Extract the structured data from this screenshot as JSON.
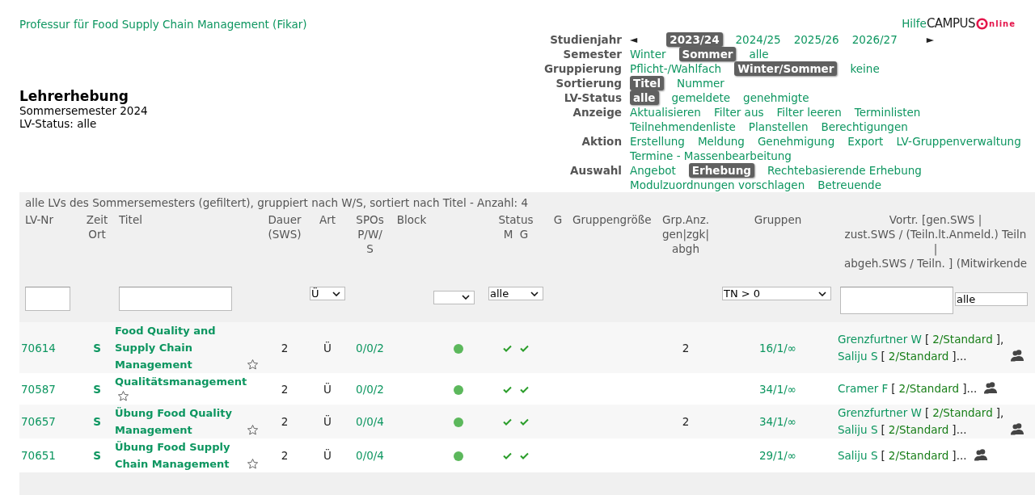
{
  "org_title": "Professur für Food Supply Chain Management (Fikar)",
  "help": "Hilfe",
  "logo": {
    "left": "CAMPUS",
    "right": "nline"
  },
  "page": {
    "title": "Lehrerhebung",
    "subtitle": "Sommersemester 2024",
    "status": "LV-Status: alle"
  },
  "nav": [
    {
      "label": "Studienjahr",
      "prev": "◄",
      "next": "►",
      "items": [
        {
          "text": "2023/24",
          "selected": true
        },
        {
          "text": "2024/25",
          "selected": false
        },
        {
          "text": "2025/26",
          "selected": false
        },
        {
          "text": "2026/27",
          "selected": false
        }
      ]
    },
    {
      "label": "Semester",
      "items": [
        {
          "text": "Winter",
          "selected": false
        },
        {
          "text": "Sommer",
          "selected": true
        },
        {
          "text": "alle",
          "selected": false
        }
      ]
    },
    {
      "label": "Gruppierung",
      "items": [
        {
          "text": "Pflicht-/Wahlfach",
          "selected": false
        },
        {
          "text": "Winter/Sommer",
          "selected": true
        },
        {
          "text": "keine",
          "selected": false
        }
      ]
    },
    {
      "label": "Sortierung",
      "items": [
        {
          "text": "Titel",
          "selected": true
        },
        {
          "text": "Nummer",
          "selected": false
        }
      ]
    },
    {
      "label": "LV-Status",
      "items": [
        {
          "text": "alle",
          "selected": true
        },
        {
          "text": "gemeldete",
          "selected": false
        },
        {
          "text": "genehmigte",
          "selected": false
        }
      ]
    },
    {
      "label": "Anzeige",
      "items": [
        {
          "text": "Aktualisieren",
          "selected": false
        },
        {
          "text": "Filter aus",
          "selected": false
        },
        {
          "text": "Filter leeren",
          "selected": false
        },
        {
          "text": "Terminlisten",
          "selected": false
        },
        {
          "text": "Teilnehmendenliste",
          "selected": false
        },
        {
          "text": "Planstellen",
          "selected": false
        },
        {
          "text": "Berechtigungen",
          "selected": false
        }
      ]
    },
    {
      "label": "Aktion",
      "items": [
        {
          "text": "Erstellung",
          "selected": false
        },
        {
          "text": "Meldung",
          "selected": false
        },
        {
          "text": "Genehmigung",
          "selected": false
        },
        {
          "text": "Export",
          "selected": false
        },
        {
          "text": "LV-Gruppenverwaltung",
          "selected": false
        },
        {
          "text": "Termine - Massenbearbeitung",
          "selected": false
        }
      ]
    },
    {
      "label": "Auswahl",
      "items": [
        {
          "text": "Angebot",
          "selected": false
        },
        {
          "text": "Erhebung",
          "selected": true
        },
        {
          "text": "Rechtebasierende Erhebung",
          "selected": false
        },
        {
          "text": "Modulzuordnungen vorschlagen",
          "selected": false
        },
        {
          "text": "Betreuende",
          "selected": false
        }
      ]
    }
  ],
  "table": {
    "caption": "alle LVs des Sommersemesters (gefiltert), gruppiert nach W/S, sortiert nach Titel - Anzahl: 4",
    "columns": [
      {
        "lines": [
          "LV-Nr"
        ]
      },
      {
        "lines": [
          "Zeit",
          "Ort"
        ]
      },
      {
        "lines": [
          "Titel"
        ]
      },
      {
        "lines": [
          "Dauer",
          "(SWS)"
        ]
      },
      {
        "lines": [
          "Art"
        ]
      },
      {
        "lines": [
          "SPOs",
          "P/W/",
          "S"
        ]
      },
      {
        "lines": [
          "Block"
        ]
      },
      {
        "lines": [
          "Status",
          "M  G"
        ]
      },
      {
        "lines": [
          "G"
        ]
      },
      {
        "lines": [
          "Gruppengröße"
        ]
      },
      {
        "lines": [
          "Grp.Anz.",
          "gen|zgk|",
          "abgh"
        ]
      },
      {
        "lines": [
          "Gruppen"
        ]
      },
      {
        "lines": [
          "Vortr. [gen.SWS |",
          "zust.SWS / (Teiln.lt.Anmeld.) Teiln",
          "|",
          "abgeh.SWS / Teiln. ] (Mitwirkende"
        ]
      }
    ],
    "filters": [
      {
        "kind": "text"
      },
      {
        "kind": "blank"
      },
      {
        "kind": "text"
      },
      {
        "kind": "blank"
      },
      {
        "kind": "select",
        "value": "Ü"
      },
      {
        "kind": "blank"
      },
      {
        "kind": "blank"
      },
      {
        "kind": "select"
      },
      {
        "kind": "select",
        "value": "alle"
      },
      {
        "kind": "blank"
      },
      {
        "kind": "blank"
      },
      {
        "kind": "blank"
      },
      {
        "kind": "select",
        "value": "TN > 0"
      },
      {
        "kind": "text-select",
        "value": "alle"
      }
    ],
    "rows": [
      {
        "number": "70614",
        "time": "S",
        "title": "Food Quality and Supply Chain Management",
        "favorite": false,
        "duration": "2",
        "type": "Ü",
        "spos": "0/0/2",
        "color": "#5cb85c",
        "m_ok": true,
        "g_ok": true,
        "group_count": "2",
        "groups": "16/1/∞",
        "lecturers": [
          {
            "name": "Grenzfurtner W",
            "open": "[",
            "sws": "2/Standard",
            "close": "],"
          },
          {
            "name": "Saliju S",
            "open": "[",
            "sws": "2/Standard",
            "close": "]..."
          }
        ]
      },
      {
        "number": "70587",
        "time": "S",
        "title": "Qualitätsmanagement",
        "favorite": false,
        "duration": "2",
        "type": "Ü",
        "spos": "0/0/2",
        "color": "#5cb85c",
        "m_ok": true,
        "g_ok": true,
        "groups": "34/1/∞",
        "lecturers": [
          {
            "name": "Cramer F",
            "open": "[",
            "sws": "2/Standard",
            "close": "]..."
          }
        ]
      },
      {
        "number": "70657",
        "time": "S",
        "title": "Übung Food Quality Management",
        "favorite": false,
        "duration": "2",
        "type": "Ü",
        "spos": "0/0/4",
        "color": "#5cb85c",
        "m_ok": true,
        "g_ok": true,
        "group_count": "2",
        "groups": "34/1/∞",
        "lecturers": [
          {
            "name": "Grenzfurtner W",
            "open": "[",
            "sws": "2/Standard",
            "close": "],"
          },
          {
            "name": "Saliju S",
            "open": "[",
            "sws": "2/Standard",
            "close": "]..."
          }
        ]
      },
      {
        "number": "70651",
        "time": "S",
        "title": "Übung Food Supply Chain Management",
        "favorite": false,
        "duration": "2",
        "type": "Ü",
        "spos": "0/0/4",
        "color": "#5cb85c",
        "m_ok": true,
        "g_ok": true,
        "groups": "29/1/∞",
        "lecturers": [
          {
            "name": "Saliju S",
            "open": "[",
            "sws": "2/Standard",
            "close": "]..."
          }
        ]
      }
    ]
  }
}
